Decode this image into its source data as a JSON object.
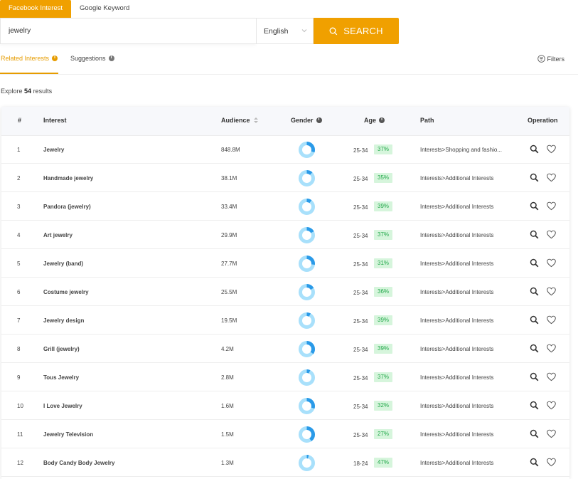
{
  "top_tabs": [
    "Facebook Interest",
    "Google Keyword"
  ],
  "search": {
    "value": "jewelry",
    "language": "English",
    "button_label": "SEARCH"
  },
  "sub_tabs": {
    "related": "Related Interests",
    "suggestions": "Suggestions",
    "filters": "Filters"
  },
  "explore": {
    "prefix": "Explore",
    "count": "54",
    "suffix": "results"
  },
  "colors": {
    "accent": "#f0a000",
    "gender_female": "#a8e0fb",
    "gender_male": "#2a9ae8",
    "age_badge_bg": "#d6f5dc",
    "age_badge_text": "#22a84a"
  },
  "table": {
    "headers": {
      "num": "#",
      "interest": "Interest",
      "audience": "Audience",
      "gender": "Gender",
      "age": "Age",
      "path": "Path",
      "operation": "Operation"
    },
    "rows": [
      {
        "num": "1",
        "interest": "Jewelry",
        "audience": "848.8M",
        "male_share": 0.3,
        "age_range": "25-34",
        "age_pct": "37%",
        "path": "Interests>Shopping and fashio..."
      },
      {
        "num": "2",
        "interest": "Handmade jewelry",
        "audience": "38.1M",
        "male_share": 0.12,
        "age_range": "25-34",
        "age_pct": "35%",
        "path": "Interests>Additional Interests"
      },
      {
        "num": "3",
        "interest": "Pandora (jewelry)",
        "audience": "33.4M",
        "male_share": 0.1,
        "age_range": "25-34",
        "age_pct": "39%",
        "path": "Interests>Additional Interests"
      },
      {
        "num": "4",
        "interest": "Art jewelry",
        "audience": "29.9M",
        "male_share": 0.17,
        "age_range": "25-34",
        "age_pct": "37%",
        "path": "Interests>Additional Interests"
      },
      {
        "num": "5",
        "interest": "Jewelry (band)",
        "audience": "27.7M",
        "male_share": 0.27,
        "age_range": "25-34",
        "age_pct": "31%",
        "path": "Interests>Additional Interests"
      },
      {
        "num": "6",
        "interest": "Costume jewelry",
        "audience": "25.5M",
        "male_share": 0.16,
        "age_range": "25-34",
        "age_pct": "36%",
        "path": "Interests>Additional Interests"
      },
      {
        "num": "7",
        "interest": "Jewelry design",
        "audience": "19.5M",
        "male_share": 0.08,
        "age_range": "25-34",
        "age_pct": "39%",
        "path": "Interests>Additional Interests"
      },
      {
        "num": "8",
        "interest": "Grill (jewelry)",
        "audience": "4.2M",
        "male_share": 0.35,
        "age_range": "25-34",
        "age_pct": "39%",
        "path": "Interests>Additional Interests"
      },
      {
        "num": "9",
        "interest": "Tous Jewelry",
        "audience": "2.8M",
        "male_share": 0.07,
        "age_range": "25-34",
        "age_pct": "37%",
        "path": "Interests>Additional Interests"
      },
      {
        "num": "10",
        "interest": "I Love Jewelry",
        "audience": "1.6M",
        "male_share": 0.3,
        "age_range": "25-34",
        "age_pct": "32%",
        "path": "Interests>Additional Interests"
      },
      {
        "num": "11",
        "interest": "Jewelry Television",
        "audience": "1.5M",
        "male_share": 0.4,
        "age_range": "25-34",
        "age_pct": "27%",
        "path": "Interests>Additional Interests"
      },
      {
        "num": "12",
        "interest": "Body Candy Body Jewelry",
        "audience": "1.3M",
        "male_share": 0.04,
        "age_range": "18-24",
        "age_pct": "47%",
        "path": "Interests>Additional Interests"
      }
    ]
  }
}
